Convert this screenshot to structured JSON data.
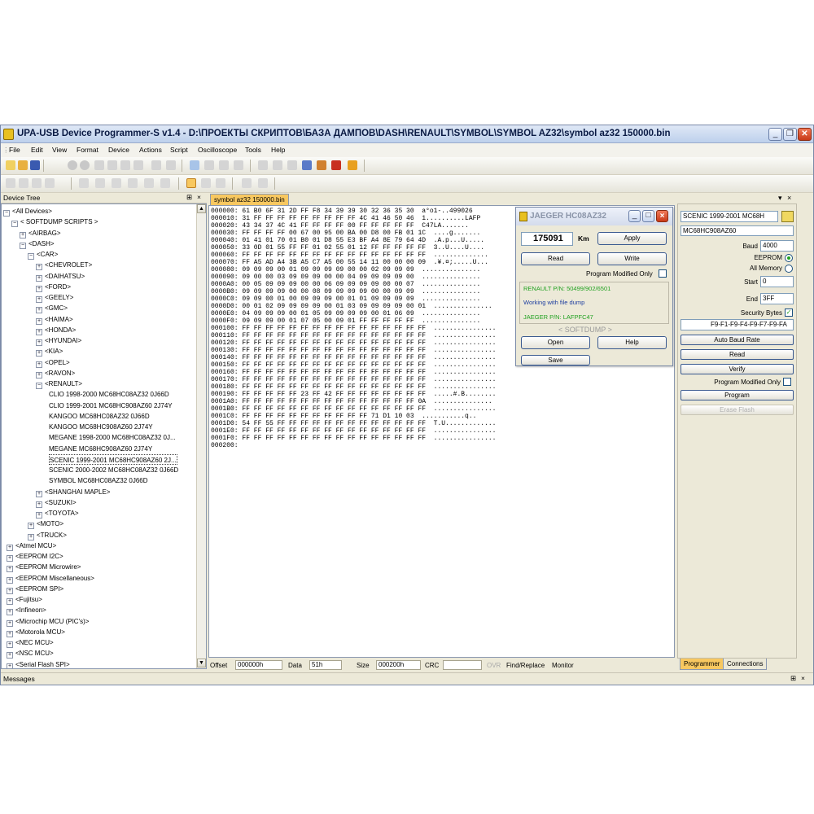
{
  "window": {
    "title": "UPA-USB Device Programmer-S v1.4 - D:\\ПРОЕКТЫ СКРИПТОВ\\БАЗА ДАМПОВ\\DASH\\RENAULT\\SYMBOL\\SYMBOL AZ32\\symbol az32 150000.bin",
    "min_glyph": "_",
    "max_glyph": "❐",
    "close_glyph": "✕"
  },
  "menu": [
    "File",
    "Edit",
    "View",
    "Format",
    "Device",
    "Actions",
    "Script",
    "Oscilloscope",
    "Tools",
    "Help"
  ],
  "device_tree": {
    "header": "Device Tree",
    "pin_glyph": "⊞",
    "close_glyph": "×",
    "nodes": [
      {
        "label": "<All Devices>",
        "pm": "−"
      },
      {
        "label": "< SOFTDUMP SCRIPTS >",
        "pm": "−"
      },
      {
        "label": "<AIRBAG>",
        "pm": "+"
      },
      {
        "label": "<DASH>",
        "pm": "−"
      },
      {
        "label": "<CAR>",
        "pm": "−"
      },
      {
        "label": "<CHEVROLET>",
        "pm": "+"
      },
      {
        "label": "<DAIHATSU>",
        "pm": "+"
      },
      {
        "label": "<FORD>",
        "pm": "+"
      },
      {
        "label": "<GEELY>",
        "pm": "+"
      },
      {
        "label": "<GMC>",
        "pm": "+"
      },
      {
        "label": "<HAIMA>",
        "pm": "+"
      },
      {
        "label": "<HONDA>",
        "pm": "+"
      },
      {
        "label": "<HYUNDAI>",
        "pm": "+"
      },
      {
        "label": "<KIA>",
        "pm": "+"
      },
      {
        "label": "<OPEL>",
        "pm": "+"
      },
      {
        "label": "<RAVON>",
        "pm": "+"
      },
      {
        "label": "<RENAULT>",
        "pm": "−"
      },
      {
        "label": "CLIO 1998-2000 MC68HC08AZ32 0J66D",
        "pm": ""
      },
      {
        "label": "CLIO 1999-2001 MC68HC908AZ60 2J74Y",
        "pm": ""
      },
      {
        "label": "KANGOO MC68HC08AZ32 0J66D",
        "pm": ""
      },
      {
        "label": "KANGOO MC68HC908AZ60 2J74Y",
        "pm": ""
      },
      {
        "label": "MEGANE 1998-2000 MC68HC08AZ32 0J...",
        "pm": ""
      },
      {
        "label": "MEGANE MC68HC908AZ60 2J74Y",
        "pm": ""
      },
      {
        "label": "SCENIC 1999-2001 MC68HC908AZ60 2J...",
        "pm": "",
        "selected": true
      },
      {
        "label": "SCENIC 2000-2002 MC68HC08AZ32 0J66D",
        "pm": ""
      },
      {
        "label": "SYMBOL MC68HC08AZ32 0J66D",
        "pm": ""
      },
      {
        "label": "<SHANGHAI MAPLE>",
        "pm": "+"
      },
      {
        "label": "<SUZUKI>",
        "pm": "+"
      },
      {
        "label": "<TOYOTA>",
        "pm": "+"
      },
      {
        "label": "<MOTO>",
        "pm": "+"
      },
      {
        "label": "<TRUCK>",
        "pm": "+"
      },
      {
        "label": "<Atmel MCU>",
        "pm": "+"
      },
      {
        "label": "<EEPROM I2C>",
        "pm": "+"
      },
      {
        "label": "<EEPROM Microwire>",
        "pm": "+"
      },
      {
        "label": "<EEPROM Miscellaneous>",
        "pm": "+"
      },
      {
        "label": "<EEPROM SPI>",
        "pm": "+"
      },
      {
        "label": "<Fujitsu>",
        "pm": "+"
      },
      {
        "label": "<Infineon>",
        "pm": "+"
      },
      {
        "label": "<Microchip MCU (PIC's)>",
        "pm": "+"
      },
      {
        "label": "<Motorola MCU>",
        "pm": "+"
      },
      {
        "label": "<NEC MCU>",
        "pm": "+"
      },
      {
        "label": "<NSC MCU>",
        "pm": "+"
      },
      {
        "label": "<Serial Flash SPI>",
        "pm": "+"
      }
    ]
  },
  "file_tab": "symbol az32 150000.bin",
  "hex_lines": [
    "000000: 61 B0 6F 31 2D FF F8 34 39 39 30 32 36 35 30  a°o1-..499026",
    "000010: 31 FF FF FF FF FF FF FF FF FF 4C 41 46 50 46  1..........LAFP",
    "000020: 43 34 37 4C 41 FF FF FF FF 00 FF FF FF FF FF  C47LA.......",
    "000030: FF FF FF FF 00 67 00 95 00 BA 00 D8 00 FB 01 1C  ....g.......",
    "000040: 01 41 01 70 01 B0 01 D8 55 E3 BF A4 8E 79 64 4D  .A.p...U.....",
    "000050: 33 0D 01 55 FF FF 01 02 55 01 12 FF FF FF FF FF  3..U....U....",
    "000060: FF FF FF FF FF FF FF FF FF FF FF FF FF FF FF FF  ..............",
    "000070: FF A5 AD A4 3B A5 C7 A5 00 55 14 11 00 00 00 09  .¥.¤;.....U...",
    "000080: 09 09 09 00 01 09 09 09 09 00 00 02 09 09 09  ...............",
    "000090: 09 00 00 03 09 09 09 00 00 04 09 09 09 09 00  ...............",
    "0000A0: 00 05 09 09 09 00 00 06 09 09 09 09 00 00 07  ...............",
    "0000B0: 09 09 09 09 00 00 08 09 09 09 09 00 00 09 09  ...............",
    "0000C0: 09 09 00 01 00 09 09 09 00 01 01 09 09 09 09  ...............",
    "0000D0: 00 01 02 09 09 09 09 00 01 03 09 09 09 09 00 01  ...............",
    "0000E0: 04 09 09 09 00 01 05 09 09 09 09 00 01 06 09  ...............",
    "0000F0: 09 09 09 00 01 07 05 00 09 01 FF FF FF FF FF  ...............",
    "000100: FF FF FF FF FF FF FF FF FF FF FF FF FF FF FF FF  ................",
    "000110: FF FF FF FF FF FF FF FF FF FF FF FF FF FF FF FF  ................",
    "000120: FF FF FF FF FF FF FF FF FF FF FF FF FF FF FF FF  ................",
    "000130: FF FF FF FF FF FF FF FF FF FF FF FF FF FF FF FF  ................",
    "000140: FF FF FF FF FF FF FF FF FF FF FF FF FF FF FF FF  ................",
    "000150: FF FF FF FF FF FF FF FF FF FF FF FF FF FF FF FF  ................",
    "000160: FF FF FF FF FF FF FF FF FF FF FF FF FF FF FF FF  ................",
    "000170: FF FF FF FF FF FF FF FF FF FF FF FF FF FF FF FF  ................",
    "000180: FF FF FF FF FF FF FF FF FF FF FF FF FF FF FF FF  ................",
    "000190: FF FF FF FF FF 23 FF 42 FF FF FF FF FF FF FF FF  .....#.B........",
    "0001A0: FF FF FF FF FF FF FF FF FF FF FF FF FF FF FF 0A  ...............",
    "0001B0: FF FF FF FF FF FF FF FF FF FF FF FF FF FF FF FF  ................",
    "0001C0: FF FF FF FF FF FF FF FF FF FF FF 71 D1 10 03  ...........q..",
    "0001D0: 54 FF 55 FF FF FF FF FF FF FF FF FF FF FF FF FF  T.U.............",
    "0001E0: FF FF FF FF FF FF FF FF FF FF FF FF FF FF FF FF  ................",
    "0001F0: FF FF FF FF FF FF FF FF FF FF FF FF FF FF FF FF  ................",
    "000200:"
  ],
  "status": {
    "offset_label": "Offset",
    "offset_value": "000000h",
    "data_label": "Data",
    "data_value": "51h",
    "size_label": "Size",
    "size_value": "000200h",
    "crc_label": "CRC",
    "crc_value": "",
    "ovr": "OVR",
    "find_replace": "Find/Replace",
    "monitor": "Monitor"
  },
  "dialog": {
    "title": "JAEGER HC08AZ32",
    "km_value": "175091",
    "km_label": "Km",
    "apply": "Apply",
    "read": "Read",
    "write": "Write",
    "program_modified": "Program Modified Only",
    "info1": "RENAULT P/N:  50499/902/6501",
    "info2": "Working with file dump",
    "info3": "JAEGER P/N:  LAFPFC47",
    "brand": "< SOFTDUMP >",
    "open": "Open",
    "help": "Help",
    "save": "Save"
  },
  "right_panel": {
    "device_select": "SCENIC 1999-2001 MC68H",
    "device_name": "MC68HC908AZ60",
    "baud_label": "Baud",
    "baud_value": "4000",
    "eeprom_label": "EEPROM",
    "allmem_label": "All Memory",
    "start_label": "Start",
    "start_value": "0",
    "end_label": "End",
    "end_value": "3FF",
    "secbytes_label": "Security Bytes",
    "secbytes_value": "F9-F1-F9-F4-F9-F7-F9-FA",
    "auto_baud": "Auto Baud Rate",
    "read": "Read",
    "verify": "Verify",
    "prog_mod_only": "Program Modified Only",
    "program": "Program",
    "erase": "Erase Flash",
    "tab_programmer": "Programmer",
    "tab_connections": "Connections"
  },
  "messages": {
    "label": "Messages",
    "pin_glyph": "⊞",
    "close_glyph": "×"
  },
  "colors": {
    "accent_green": "#21a121",
    "title_blue": "#0a1a44",
    "tab_orange": "#f8c860"
  }
}
